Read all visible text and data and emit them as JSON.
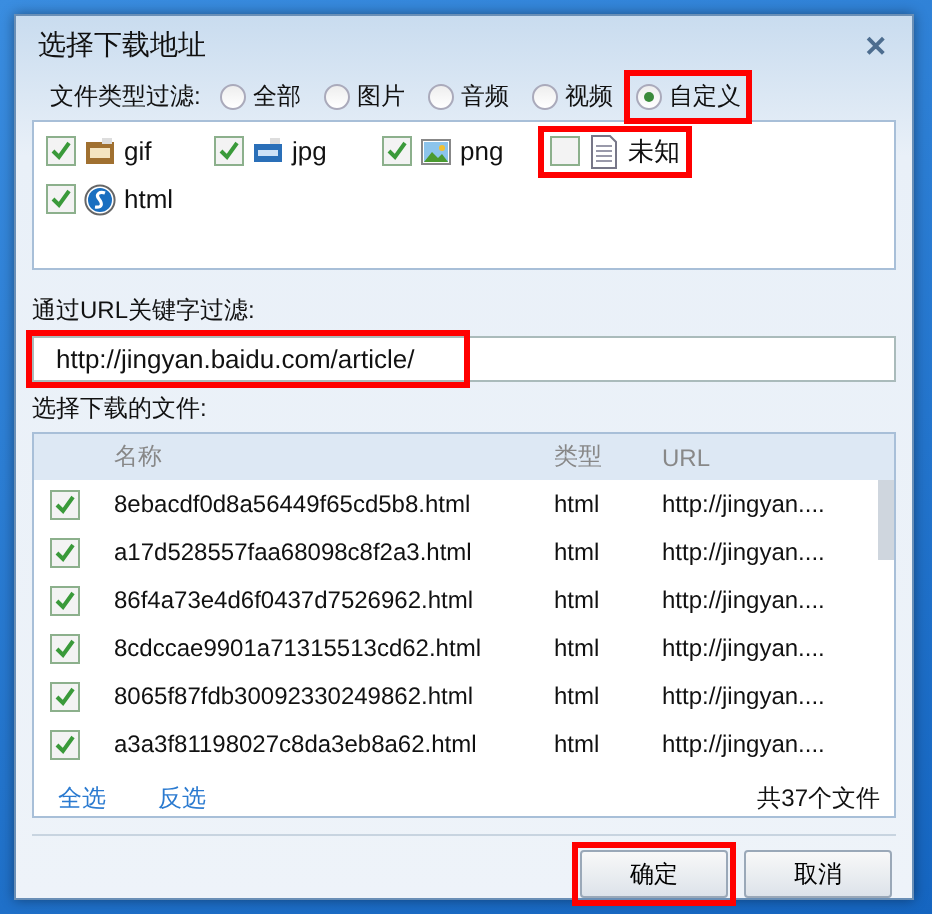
{
  "window": {
    "title": "选择下载地址",
    "close": "✕"
  },
  "type_filter": {
    "label": "文件类型过滤:",
    "options": [
      {
        "label": "全部",
        "selected": false,
        "highlighted": false
      },
      {
        "label": "图片",
        "selected": false,
        "highlighted": false
      },
      {
        "label": "音频",
        "selected": false,
        "highlighted": false
      },
      {
        "label": "视频",
        "selected": false,
        "highlighted": false
      },
      {
        "label": "自定义",
        "selected": true,
        "highlighted": true
      }
    ]
  },
  "file_types": [
    {
      "label": "gif",
      "kind": "gif",
      "checked": true,
      "highlighted": false
    },
    {
      "label": "jpg",
      "kind": "jpg",
      "checked": true,
      "highlighted": false
    },
    {
      "label": "png",
      "kind": "png",
      "checked": true,
      "highlighted": false
    },
    {
      "label": "未知",
      "kind": "unknown",
      "checked": false,
      "highlighted": true
    },
    {
      "label": "html",
      "kind": "html",
      "checked": true,
      "highlighted": false
    }
  ],
  "url_filter": {
    "label": "通过URL关键字过滤:",
    "value": "http://jingyan.baidu.com/article/",
    "highlighted": true
  },
  "files": {
    "label": "选择下载的文件:",
    "columns": [
      "名称",
      "类型",
      "URL"
    ],
    "rows": [
      {
        "checked": true,
        "name": "8ebacdf0d8a56449f65cd5b8.html",
        "type": "html",
        "url": "http://jingyan...."
      },
      {
        "checked": true,
        "name": "a17d528557faa68098c8f2a3.html",
        "type": "html",
        "url": "http://jingyan...."
      },
      {
        "checked": true,
        "name": "86f4a73e4d6f0437d7526962.html",
        "type": "html",
        "url": "http://jingyan...."
      },
      {
        "checked": true,
        "name": "8cdccae9901a71315513cd62.html",
        "type": "html",
        "url": "http://jingyan...."
      },
      {
        "checked": true,
        "name": "8065f87fdb30092330249862.html",
        "type": "html",
        "url": "http://jingyan...."
      },
      {
        "checked": true,
        "name": "a3a3f81198027c8da3eb8a62.html",
        "type": "html",
        "url": "http://jingyan...."
      }
    ],
    "links": [
      "全选",
      "反选"
    ],
    "count": "共37个文件"
  },
  "buttons": [
    {
      "label": "确定",
      "highlighted": true
    },
    {
      "label": "取消",
      "highlighted": false
    }
  ]
}
